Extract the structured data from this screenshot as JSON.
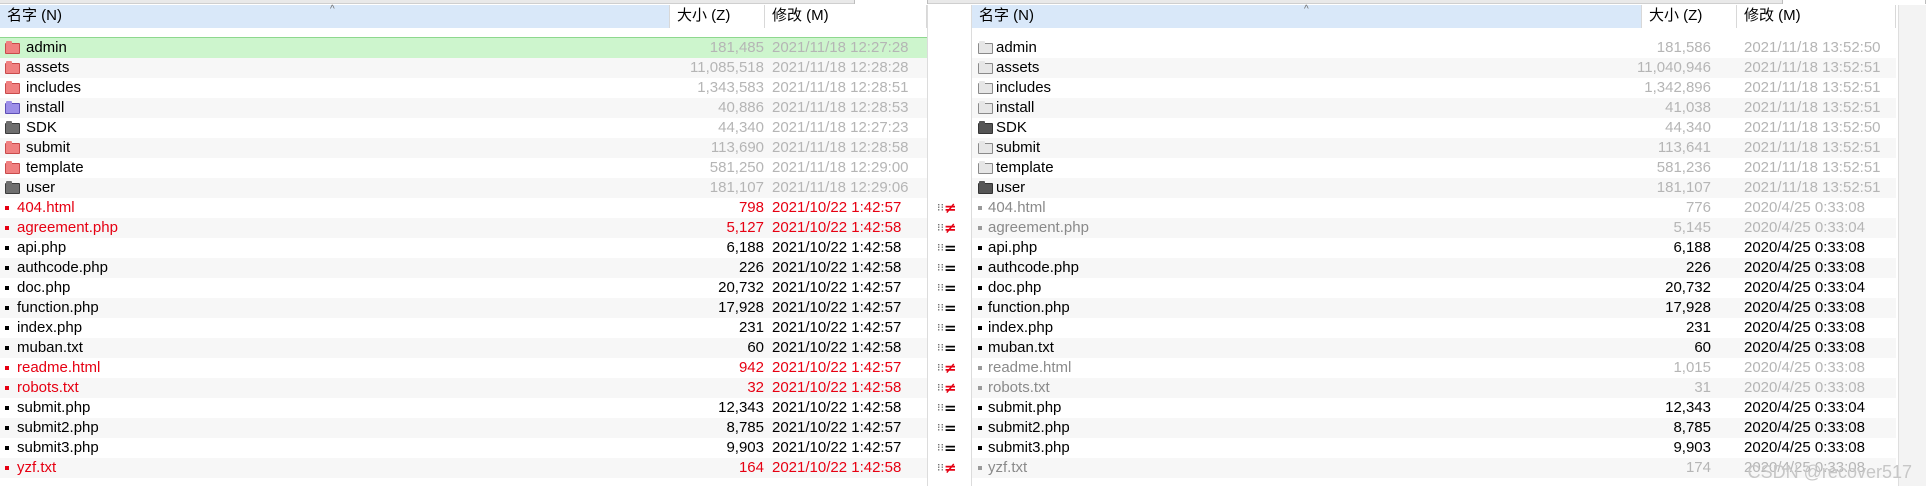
{
  "columns": {
    "name": "名字 (N)",
    "size": "大小 (Z)",
    "modified": "修改 (M)"
  },
  "left": {
    "rows": [
      {
        "kind": "folder",
        "color": "red",
        "name": "admin",
        "size": "181,485",
        "date": "2021/11/18 12:27:28",
        "state": "selected"
      },
      {
        "kind": "folder",
        "color": "red",
        "name": "assets",
        "size": "11,085,518",
        "date": "2021/11/18 12:28:28",
        "state": "muted"
      },
      {
        "kind": "folder",
        "color": "red",
        "name": "includes",
        "size": "1,343,583",
        "date": "2021/11/18 12:28:51",
        "state": "muted"
      },
      {
        "kind": "folder",
        "color": "purple",
        "name": "install",
        "size": "40,886",
        "date": "2021/11/18 12:28:53",
        "state": "muted"
      },
      {
        "kind": "folder",
        "color": "dark",
        "name": "SDK",
        "size": "44,340",
        "date": "2021/11/18 12:27:23",
        "state": "muted"
      },
      {
        "kind": "folder",
        "color": "red",
        "name": "submit",
        "size": "113,690",
        "date": "2021/11/18 12:28:58",
        "state": "muted"
      },
      {
        "kind": "folder",
        "color": "red",
        "name": "template",
        "size": "581,250",
        "date": "2021/11/18 12:29:00",
        "state": "muted"
      },
      {
        "kind": "folder",
        "color": "dark",
        "name": "user",
        "size": "181,107",
        "date": "2021/11/18 12:29:06",
        "state": "muted"
      },
      {
        "kind": "file",
        "name": "404.html",
        "size": "798",
        "date": "2021/10/22 1:42:57",
        "state": "diff"
      },
      {
        "kind": "file",
        "name": "agreement.php",
        "size": "5,127",
        "date": "2021/10/22 1:42:58",
        "state": "diff"
      },
      {
        "kind": "file",
        "name": "api.php",
        "size": "6,188",
        "date": "2021/10/22 1:42:58",
        "state": "same"
      },
      {
        "kind": "file",
        "name": "authcode.php",
        "size": "226",
        "date": "2021/10/22 1:42:58",
        "state": "same"
      },
      {
        "kind": "file",
        "name": "doc.php",
        "size": "20,732",
        "date": "2021/10/22 1:42:57",
        "state": "same"
      },
      {
        "kind": "file",
        "name": "function.php",
        "size": "17,928",
        "date": "2021/10/22 1:42:57",
        "state": "same"
      },
      {
        "kind": "file",
        "name": "index.php",
        "size": "231",
        "date": "2021/10/22 1:42:57",
        "state": "same"
      },
      {
        "kind": "file",
        "name": "muban.txt",
        "size": "60",
        "date": "2021/10/22 1:42:58",
        "state": "same"
      },
      {
        "kind": "file",
        "name": "readme.html",
        "size": "942",
        "date": "2021/10/22 1:42:57",
        "state": "diff"
      },
      {
        "kind": "file",
        "name": "robots.txt",
        "size": "32",
        "date": "2021/10/22 1:42:58",
        "state": "diff"
      },
      {
        "kind": "file",
        "name": "submit.php",
        "size": "12,343",
        "date": "2021/10/22 1:42:58",
        "state": "same"
      },
      {
        "kind": "file",
        "name": "submit2.php",
        "size": "8,785",
        "date": "2021/10/22 1:42:57",
        "state": "same"
      },
      {
        "kind": "file",
        "name": "submit3.php",
        "size": "9,903",
        "date": "2021/10/22 1:42:57",
        "state": "same"
      },
      {
        "kind": "file",
        "name": "yzf.txt",
        "size": "164",
        "date": "2021/10/22 1:42:58",
        "state": "diff"
      }
    ]
  },
  "compare": [
    {
      "symbol": "≠",
      "color": "#e60012"
    },
    {
      "symbol": "≠",
      "color": "#e60012"
    },
    {
      "symbol": "=",
      "color": "#000000"
    },
    {
      "symbol": "=",
      "color": "#000000"
    },
    {
      "symbol": "=",
      "color": "#000000"
    },
    {
      "symbol": "=",
      "color": "#000000"
    },
    {
      "symbol": "=",
      "color": "#000000"
    },
    {
      "symbol": "=",
      "color": "#000000"
    },
    {
      "symbol": "≠",
      "color": "#e60012"
    },
    {
      "symbol": "≠",
      "color": "#e60012"
    },
    {
      "symbol": "=",
      "color": "#000000"
    },
    {
      "symbol": "=",
      "color": "#000000"
    },
    {
      "symbol": "=",
      "color": "#000000"
    },
    {
      "symbol": "≠",
      "color": "#e60012"
    }
  ],
  "right": {
    "rows": [
      {
        "kind": "folder",
        "color": "gray",
        "name": "admin",
        "size": "181,586",
        "date": "2021/11/18 13:52:50",
        "state": "muted"
      },
      {
        "kind": "folder",
        "color": "gray",
        "name": "assets",
        "size": "11,040,946",
        "date": "2021/11/18 13:52:51",
        "state": "muted"
      },
      {
        "kind": "folder",
        "color": "gray",
        "name": "includes",
        "size": "1,342,896",
        "date": "2021/11/18 13:52:51",
        "state": "muted"
      },
      {
        "kind": "folder",
        "color": "gray",
        "name": "install",
        "size": "41,038",
        "date": "2021/11/18 13:52:51",
        "state": "muted"
      },
      {
        "kind": "folder",
        "color": "darkgray",
        "name": "SDK",
        "size": "44,340",
        "date": "2021/11/18 13:52:50",
        "state": "muted"
      },
      {
        "kind": "folder",
        "color": "gray",
        "name": "submit",
        "size": "113,641",
        "date": "2021/11/18 13:52:51",
        "state": "muted"
      },
      {
        "kind": "folder",
        "color": "gray",
        "name": "template",
        "size": "581,236",
        "date": "2021/11/18 13:52:51",
        "state": "muted"
      },
      {
        "kind": "folder",
        "color": "darkgray",
        "name": "user",
        "size": "181,107",
        "date": "2021/11/18 13:52:51",
        "state": "muted"
      },
      {
        "kind": "file",
        "name": "404.html",
        "size": "776",
        "date": "2020/4/25 0:33:08",
        "state": "grayname"
      },
      {
        "kind": "file",
        "name": "agreement.php",
        "size": "5,145",
        "date": "2020/4/25 0:33:04",
        "state": "grayname"
      },
      {
        "kind": "file",
        "name": "api.php",
        "size": "6,188",
        "date": "2020/4/25 0:33:08",
        "state": "same"
      },
      {
        "kind": "file",
        "name": "authcode.php",
        "size": "226",
        "date": "2020/4/25 0:33:08",
        "state": "same"
      },
      {
        "kind": "file",
        "name": "doc.php",
        "size": "20,732",
        "date": "2020/4/25 0:33:04",
        "state": "same"
      },
      {
        "kind": "file",
        "name": "function.php",
        "size": "17,928",
        "date": "2020/4/25 0:33:08",
        "state": "same"
      },
      {
        "kind": "file",
        "name": "index.php",
        "size": "231",
        "date": "2020/4/25 0:33:08",
        "state": "same"
      },
      {
        "kind": "file",
        "name": "muban.txt",
        "size": "60",
        "date": "2020/4/25 0:33:08",
        "state": "same"
      },
      {
        "kind": "file",
        "name": "readme.html",
        "size": "1,015",
        "date": "2020/4/25 0:33:08",
        "state": "grayname"
      },
      {
        "kind": "file",
        "name": "robots.txt",
        "size": "31",
        "date": "2020/4/25 0:33:08",
        "state": "grayname"
      },
      {
        "kind": "file",
        "name": "submit.php",
        "size": "12,343",
        "date": "2020/4/25 0:33:04",
        "state": "same"
      },
      {
        "kind": "file",
        "name": "submit2.php",
        "size": "8,785",
        "date": "2020/4/25 0:33:08",
        "state": "same"
      },
      {
        "kind": "file",
        "name": "submit3.php",
        "size": "9,903",
        "date": "2020/4/25 0:33:08",
        "state": "same"
      },
      {
        "kind": "file",
        "name": "yzf.txt",
        "size": "174",
        "date": "2020/4/25 0:33:08",
        "state": "grayname"
      }
    ]
  },
  "watermark": "CSDN @recover517",
  "colors": {
    "diff": "#e60012",
    "muted": "#b5b5b5",
    "selected_bg": "#cdf5cd",
    "header_active": "#d9e8f9"
  }
}
